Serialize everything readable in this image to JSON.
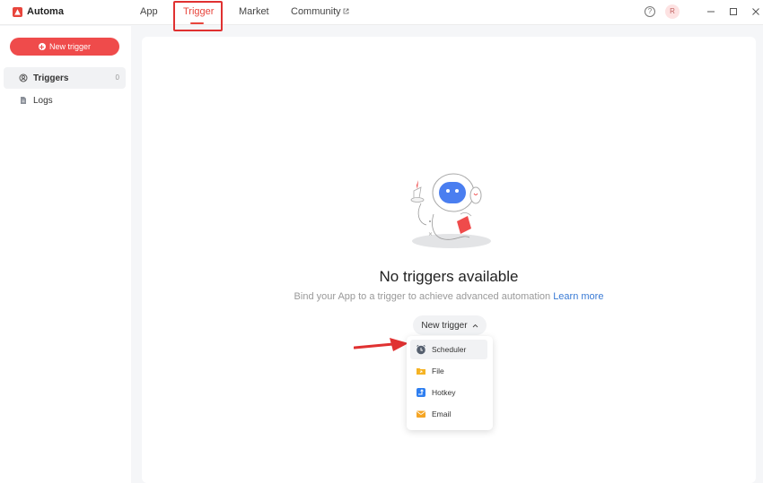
{
  "app": {
    "name": "Automa"
  },
  "nav": {
    "tabs": [
      "App",
      "Trigger",
      "Market",
      "Community"
    ],
    "active": "Trigger"
  },
  "user": {
    "avatar_initial": "R"
  },
  "sidebar": {
    "new_trigger_label": "New trigger",
    "items": [
      {
        "label": "Triggers",
        "count": "0",
        "icon": "triggers-icon"
      },
      {
        "label": "Logs",
        "icon": "document-icon"
      }
    ]
  },
  "main": {
    "empty_title": "No triggers available",
    "empty_desc": "Bind your App to a trigger to achieve advanced automation",
    "learn_more": "Learn more",
    "new_trigger_button": "New trigger"
  },
  "dropdown": {
    "items": [
      {
        "label": "Scheduler",
        "icon": "clock-icon",
        "color": "#555f6e"
      },
      {
        "label": "File",
        "icon": "folder-icon",
        "color": "#f5b324"
      },
      {
        "label": "Hotkey",
        "icon": "hotkey-icon",
        "color": "#2f7ff0"
      },
      {
        "label": "Email",
        "icon": "mail-icon",
        "color": "#f5a524"
      }
    ]
  },
  "colors": {
    "accent": "#ef4b4b",
    "annotation": "#e03131"
  }
}
